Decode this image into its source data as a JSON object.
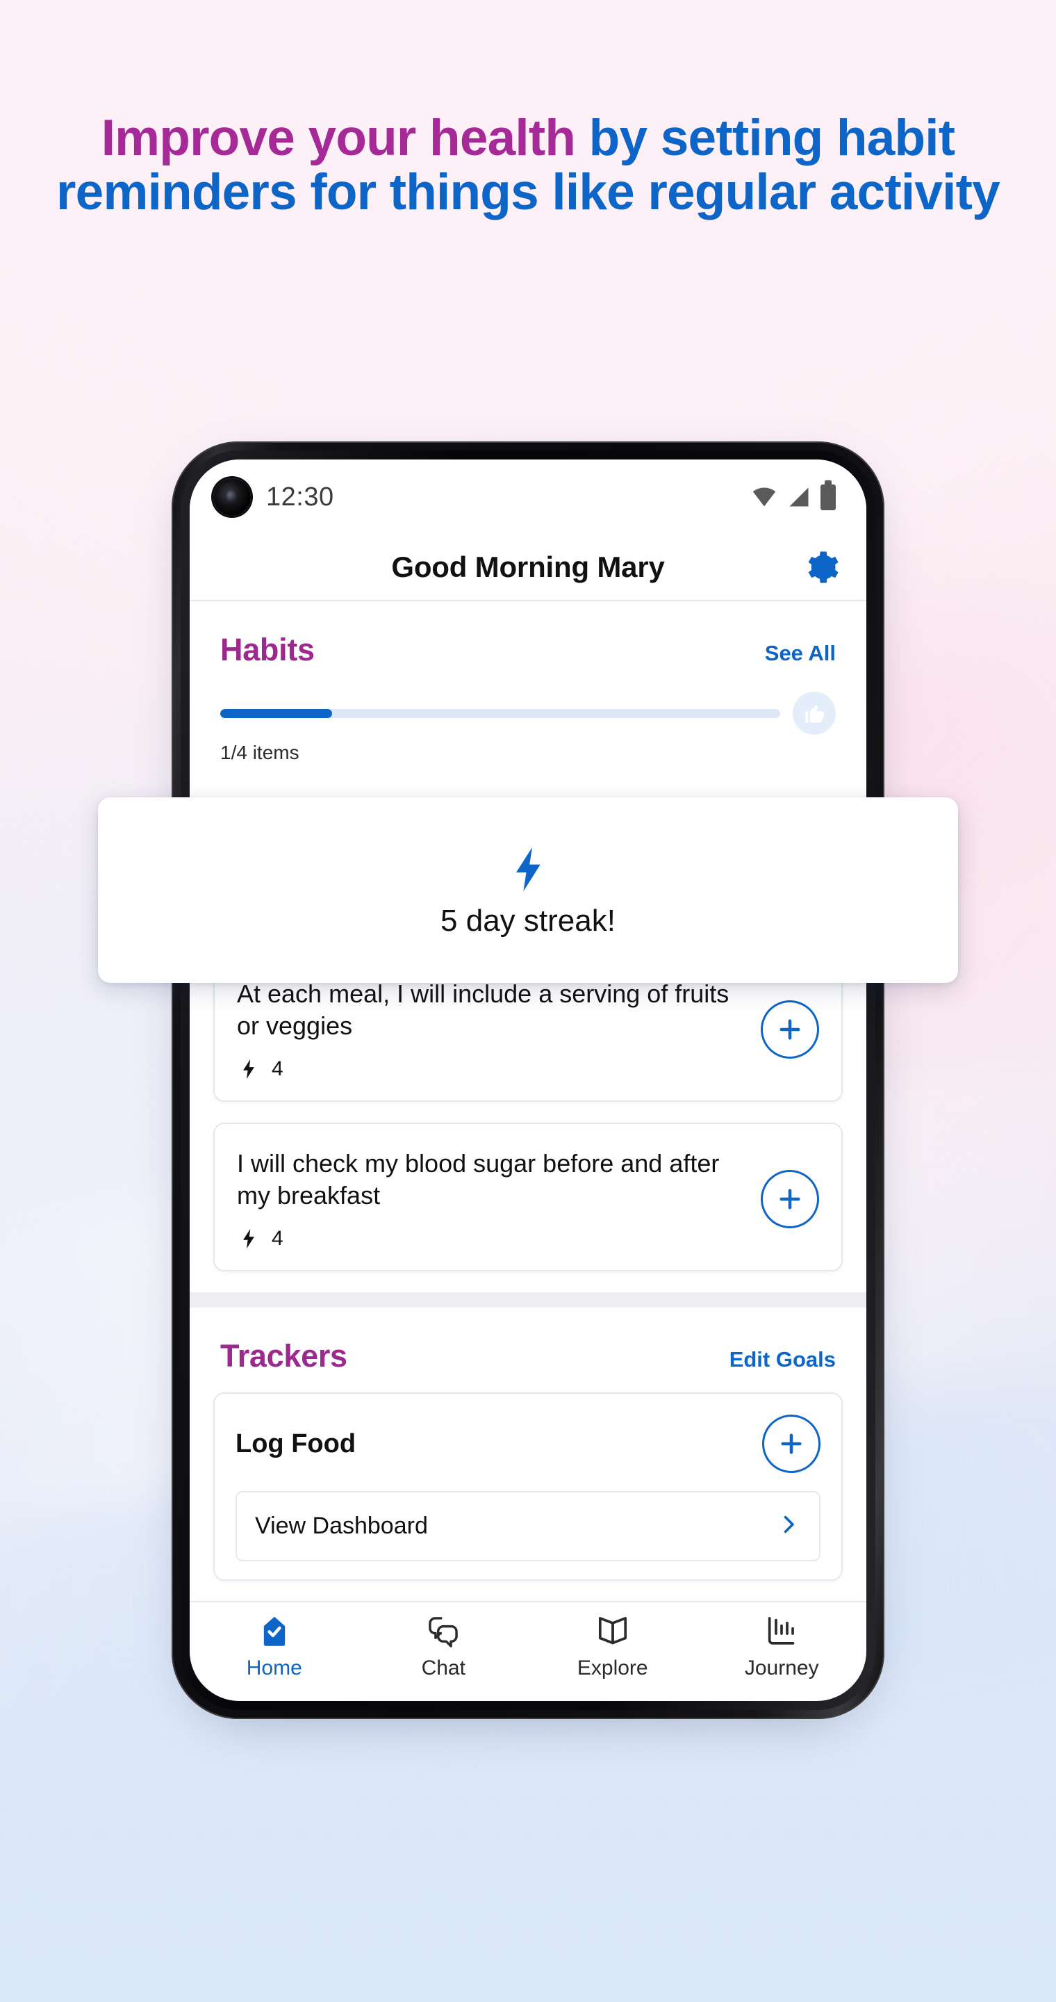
{
  "promo": {
    "headline_part1": "Improve your health",
    "headline_part2": " by setting habit reminders for things like regular activity",
    "color_pink": "#a52a97",
    "color_blue": "#0d65c8"
  },
  "phone": {
    "statusbar": {
      "time": "12:30",
      "icons": [
        "wifi-icon",
        "cellular-signal-icon",
        "battery-icon"
      ],
      "camera": "front-camera-punch-hole"
    },
    "header": {
      "title": "Good Morning Mary",
      "settings_icon": "gear-icon"
    },
    "habits": {
      "title": "Habits",
      "see_all": "See All",
      "progress_percent": 20,
      "progress_label": "1/4 items",
      "thumb_icon": "thumbs-up-icon",
      "streak": {
        "icon": "lightning-bolt-icon",
        "text": "5 day streak!"
      },
      "items": [
        {
          "text": "At each meal, I will include a serving of fruits or veggies",
          "streak_icon": "lightning-bolt-icon",
          "streak_count": "4",
          "add_icon": "plus-icon"
        },
        {
          "text": "I will check my blood sugar before and after my breakfast",
          "streak_icon": "lightning-bolt-icon",
          "streak_count": "4",
          "add_icon": "plus-icon"
        }
      ]
    },
    "trackers": {
      "title": "Trackers",
      "edit_goals": "Edit Goals",
      "card": {
        "title": "Log Food",
        "add_icon": "plus-icon",
        "dashboard_label": "View Dashboard",
        "chevron_icon": "chevron-right-icon"
      }
    },
    "bottom_nav": [
      {
        "label": "Home",
        "icon": "home-check-icon",
        "active": true
      },
      {
        "label": "Chat",
        "icon": "chat-bubbles-icon",
        "active": false
      },
      {
        "label": "Explore",
        "icon": "open-book-icon",
        "active": false
      },
      {
        "label": "Journey",
        "icon": "bar-chart-icon",
        "active": false
      }
    ]
  }
}
